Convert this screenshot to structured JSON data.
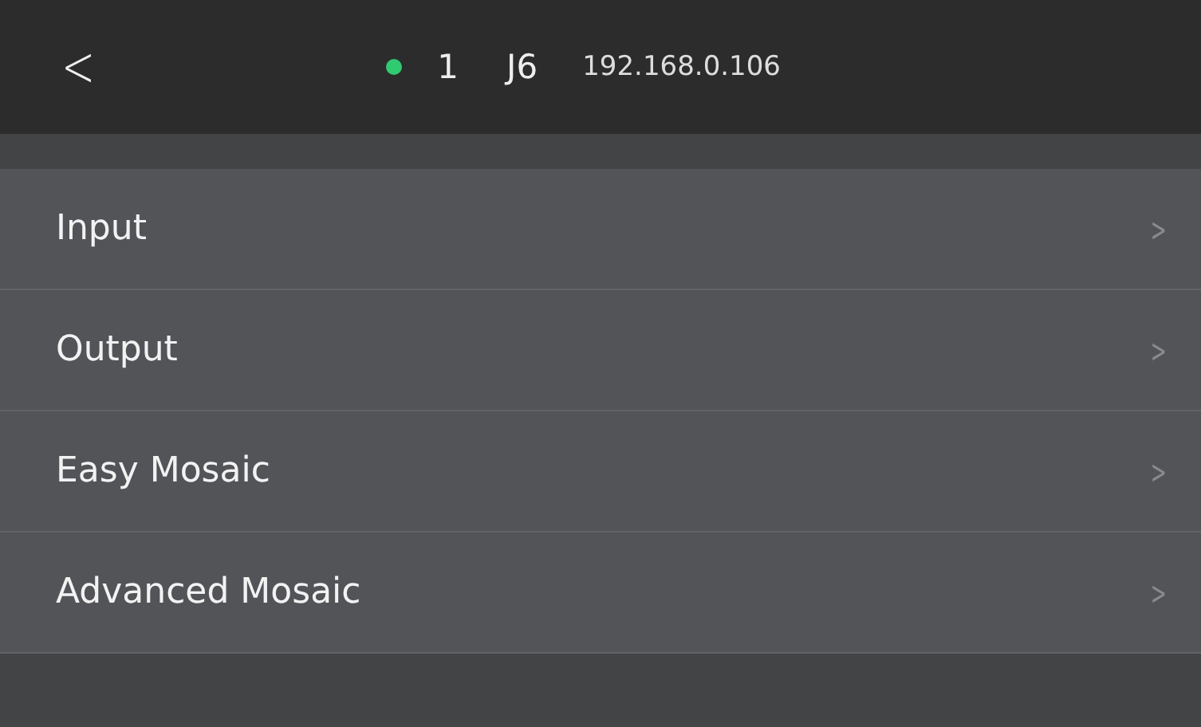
{
  "header": {
    "back": "<",
    "device": {
      "online": true,
      "index": "1",
      "name": "J6",
      "ip": "192.168.0.106"
    }
  },
  "menu": [
    {
      "label": "Input",
      "arrow": ">"
    },
    {
      "label": "Output",
      "arrow": ">"
    },
    {
      "label": "Easy Mosaic",
      "arrow": ">"
    },
    {
      "label": "Advanced Mosaic",
      "arrow": ">"
    }
  ]
}
